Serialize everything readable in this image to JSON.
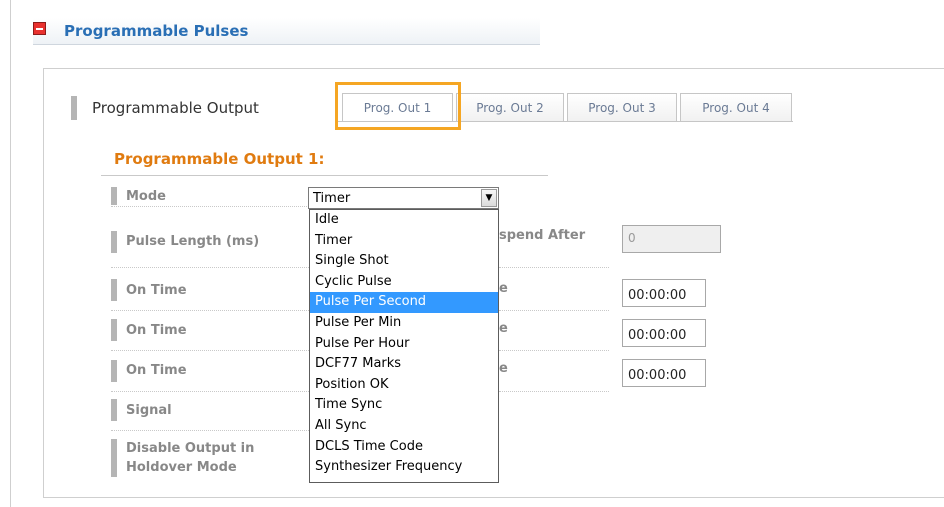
{
  "section": {
    "title": "Programmable Pulses",
    "collapse_icon": "minus-square-icon"
  },
  "tabs_row": {
    "label": "Programmable Output",
    "tabs": [
      "Prog. Out 1",
      "Prog. Out 2",
      "Prog. Out 3",
      "Prog. Out 4"
    ],
    "active_index": 0,
    "highlight_color": "#f5a623"
  },
  "form": {
    "heading": "Programmable Output 1:",
    "fields": [
      {
        "label": "Mode"
      },
      {
        "label": "Pulse Length (ms)"
      },
      {
        "label": "On Time"
      },
      {
        "label": "On Time"
      },
      {
        "label": "On Time"
      },
      {
        "label": "Signal"
      },
      {
        "label_line1": "Disable Output in",
        "label_line2": "Holdover Mode"
      }
    ],
    "right_fields": [
      {
        "label_fragment": "spend After",
        "value": "0",
        "disabled": true
      },
      {
        "label_fragment": "e",
        "value": "00:00:00"
      },
      {
        "label_fragment": "e",
        "value": "00:00:00"
      },
      {
        "label_fragment": "e",
        "value": "00:00:00"
      }
    ],
    "mode_select": {
      "value": "Timer",
      "open": true,
      "highlighted": "Pulse Per Second",
      "options": [
        "Idle",
        "Timer",
        "Single Shot",
        "Cyclic Pulse",
        "Pulse Per Second",
        "Pulse Per Min",
        "Pulse Per Hour",
        "DCF77 Marks",
        "Position OK",
        "Time Sync",
        "All Sync",
        "DCLS Time Code",
        "Synthesizer Frequency"
      ],
      "highlight_color": "#3399ff"
    }
  },
  "colors": {
    "section_title": "#2a6fb5",
    "subheading": "#e07b10",
    "field_label": "#888888"
  }
}
